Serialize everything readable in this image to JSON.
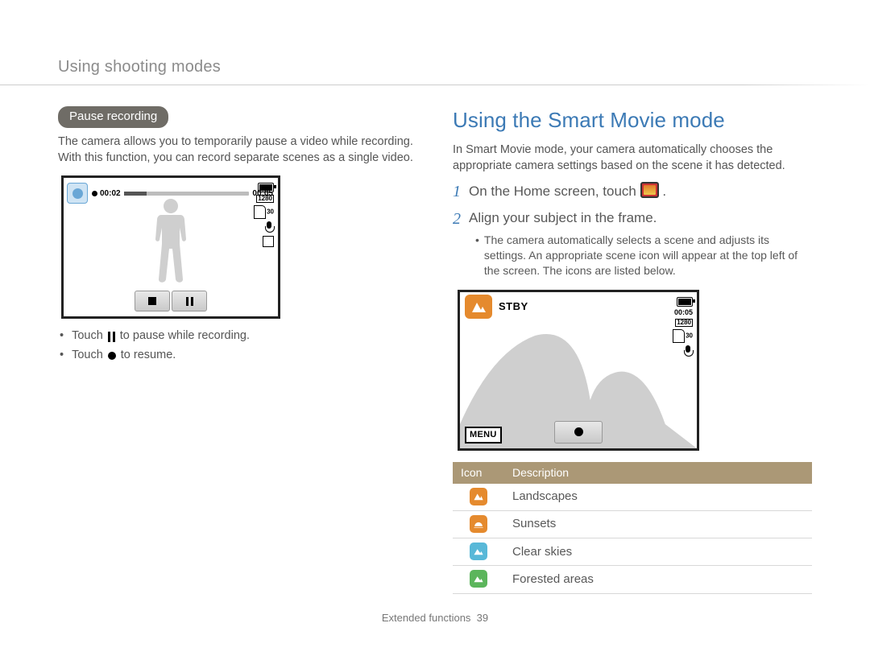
{
  "chapter": "Using shooting modes",
  "footer": {
    "section": "Extended functions",
    "page": "39"
  },
  "left": {
    "pill": "Pause recording",
    "intro": "The camera allows you to temporarily pause a video while recording. With this function, you can record separate scenes as a single video.",
    "screen": {
      "time_elapsed": "00:02",
      "time_total": "00:05",
      "res": "1280",
      "fps": "30"
    },
    "bullets": {
      "pause_pre": "Touch ",
      "pause_post": " to pause while recording.",
      "resume_pre": "Touch ",
      "resume_post": " to resume."
    }
  },
  "right": {
    "title": "Using the Smart Movie mode",
    "intro": "In Smart Movie mode, your camera automatically chooses the appropriate camera settings based on the scene it has detected.",
    "steps": {
      "s1_pre": "On the Home screen, touch ",
      "s1_post": ".",
      "s2": "Align your subject in the frame."
    },
    "sub_bullet": "The camera automatically selects a scene and adjusts its settings. An appropriate scene icon will appear at the top left of the screen. The icons are listed below.",
    "screen": {
      "stby": "STBY",
      "time": "00:05",
      "res": "1280",
      "fps": "30",
      "menu": "MENU"
    },
    "table": {
      "head_icon": "Icon",
      "head_desc": "Description",
      "rows": [
        {
          "desc": "Landscapes"
        },
        {
          "desc": "Sunsets"
        },
        {
          "desc": "Clear skies"
        },
        {
          "desc": "Forested areas"
        }
      ]
    }
  }
}
